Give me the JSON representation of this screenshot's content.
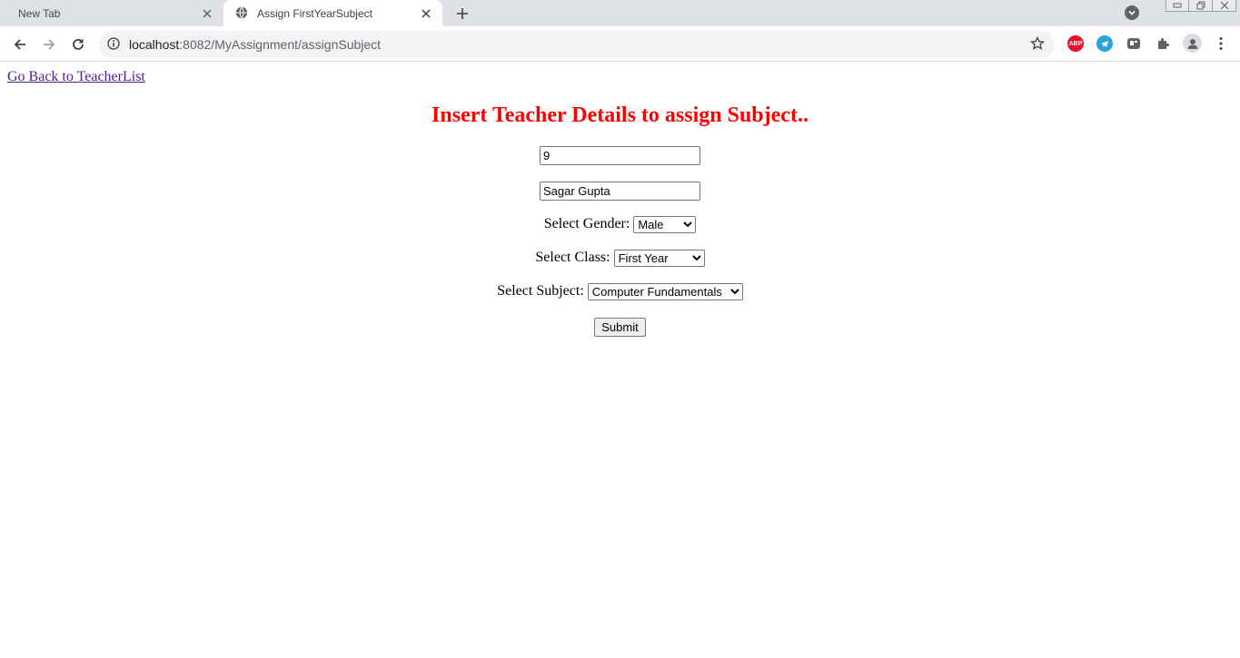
{
  "browser": {
    "tabs": [
      {
        "title": "New Tab",
        "active": false
      },
      {
        "title": "Assign FirstYearSubject",
        "active": true
      }
    ],
    "url_host": "localhost",
    "url_rest": ":8082/MyAssignment/assignSubject",
    "extensions": [
      {
        "icon": "abp-icon",
        "label": "ABP",
        "color": "#e8102a"
      },
      {
        "icon": "telegram-icon",
        "color": "#2aa3dc"
      },
      {
        "icon": "extension-app-icon",
        "color": "#5f6368"
      },
      {
        "icon": "puzzle-icon",
        "color": "#5f6368"
      },
      {
        "icon": "profile-icon",
        "color": "#5f6368"
      },
      {
        "icon": "menu-kebab-icon",
        "color": "#5f6368"
      }
    ]
  },
  "page": {
    "back_link": "Go Back to TeacherList",
    "heading": "Insert Teacher Details to assign Subject..",
    "heading_color": "#ff0000",
    "id_value": "9",
    "name_value": "Sagar Gupta",
    "gender_label": "Select Gender:",
    "gender_selected": "Male",
    "class_label": "Select Class:",
    "class_selected": "First Year",
    "subject_label": "Select Subject:",
    "subject_selected": "Computer Fundamentals",
    "submit_label": "Submit"
  }
}
